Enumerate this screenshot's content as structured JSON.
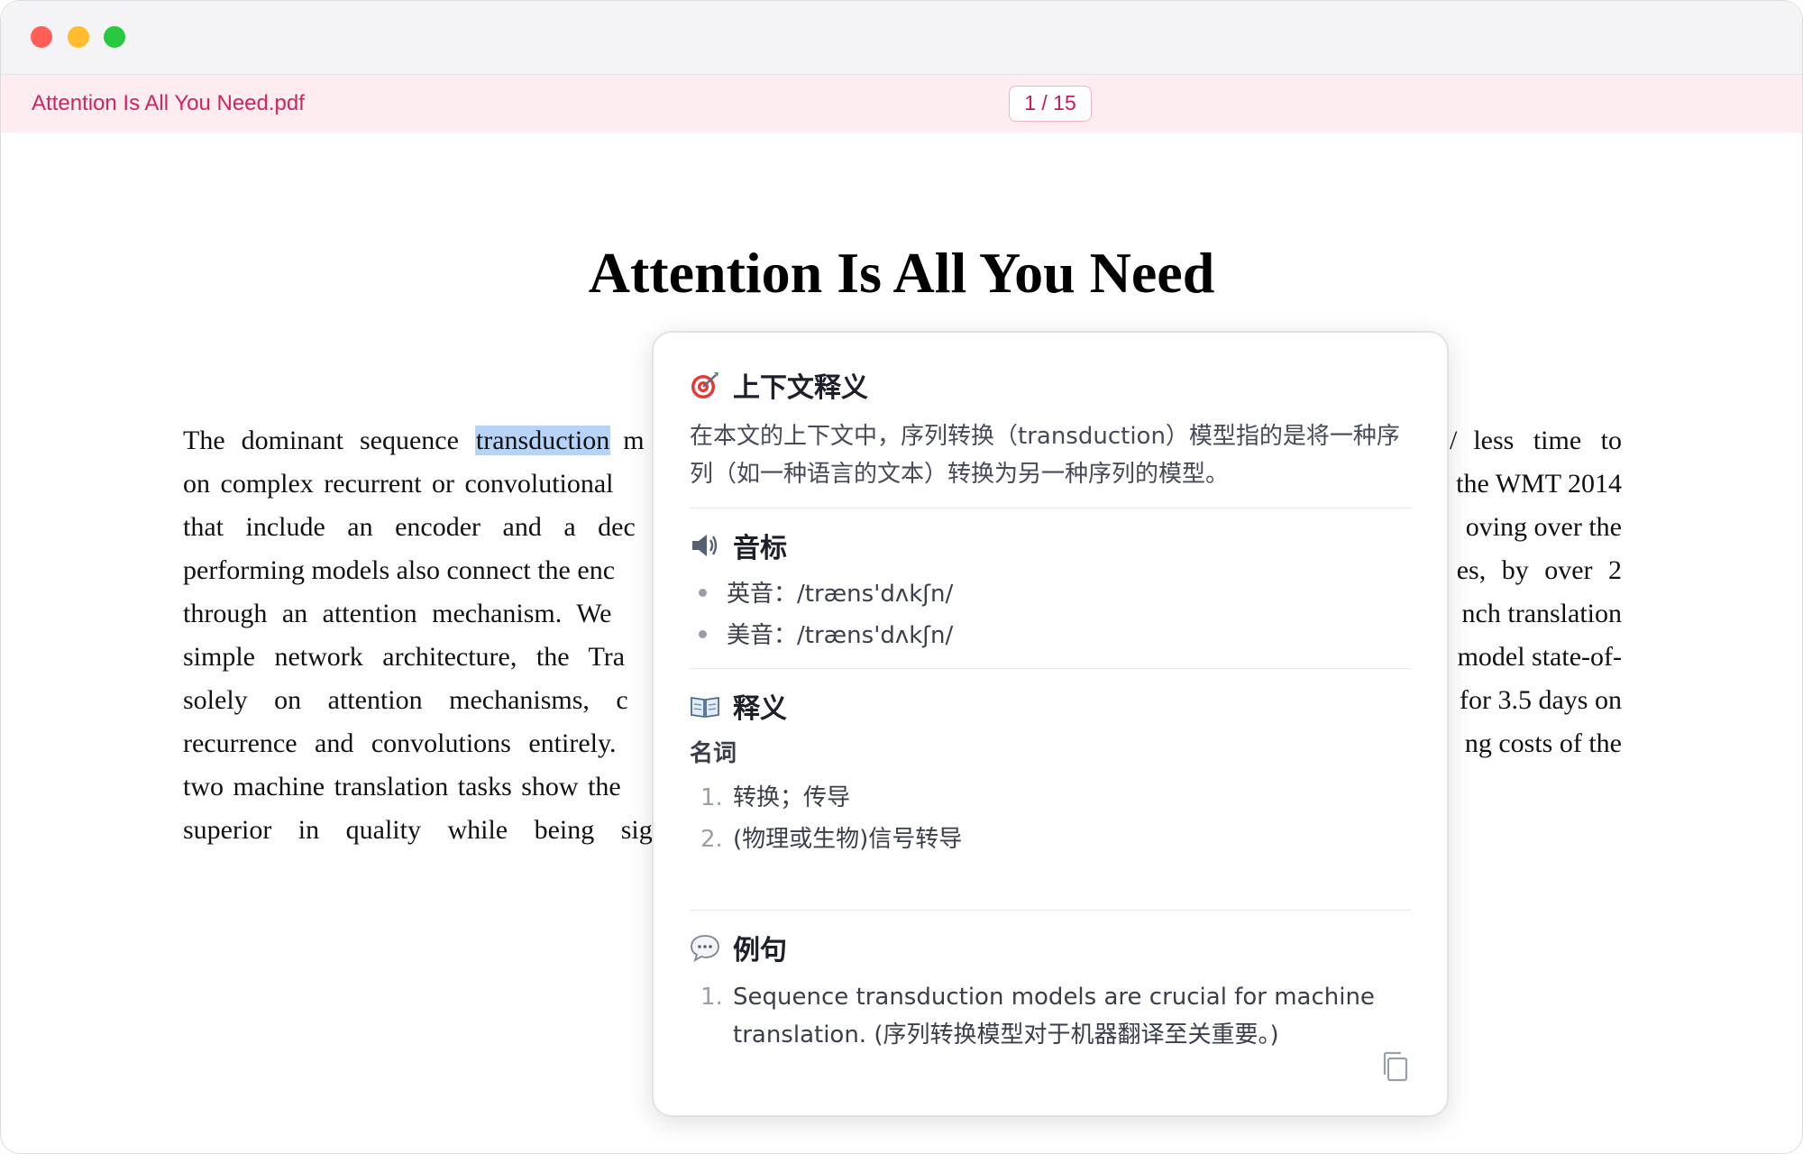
{
  "toolbar": {
    "filename": "Attention Is All You Need.pdf",
    "page_indicator": "1 / 15"
  },
  "document": {
    "title": "Attention Is All You Need",
    "lines": [
      {
        "left": [
          "The",
          "dominant",
          "sequence"
        ],
        "highlight": "transduction",
        "left_after": "m",
        "right": "less time to",
        "right_prefix": "/"
      },
      {
        "left_text": "on complex recurrent or convolutional",
        "right": "the WMT 2014"
      },
      {
        "left_text": "that include an encoder and a dec",
        "right": "oving over the"
      },
      {
        "left_text": "performing models also connect the enc",
        "right": "es, by over 2"
      },
      {
        "left_text": "through an attention mechanism. We",
        "right": "nch translation"
      },
      {
        "left_text": "simple network architecture, the Tra",
        "right": "model state-of-"
      },
      {
        "left_text": "solely on attention mechanisms, c",
        "right": "for 3.5 days on"
      },
      {
        "left_text": "recurrence and convolutions entirely.",
        "right": "ng costs of the"
      },
      {
        "left_text": "two machine translation tasks show the",
        "right": ""
      },
      {
        "left_text": "superior in quality while being sig",
        "right": ""
      }
    ]
  },
  "popup": {
    "context": {
      "heading": "上下文释义",
      "icon": "target-icon",
      "text": "在本文的上下文中，序列转换（transduction）模型指的是将一种序列（如一种语言的文本）转换为另一种序列的模型。"
    },
    "phonetic": {
      "heading": "音标",
      "icon": "speaker-icon",
      "uk": "英音：/træns'dʌkʃn/",
      "us": "美音：/træns'dʌkʃn/"
    },
    "definition": {
      "heading": "释义",
      "icon": "book-icon",
      "pos": "名词",
      "items": [
        {
          "n": "1.",
          "text": "转换；传导"
        },
        {
          "n": "2.",
          "text": "(物理或生物)信号转导"
        }
      ]
    },
    "examples": {
      "heading": "例句",
      "icon": "speech-bubble-icon",
      "items": [
        {
          "n": "1.",
          "text": "Sequence transduction models are crucial for machine translation. (序列转换模型对于机器翻译至关重要。)"
        }
      ]
    },
    "copy_icon": "copy-icon"
  }
}
